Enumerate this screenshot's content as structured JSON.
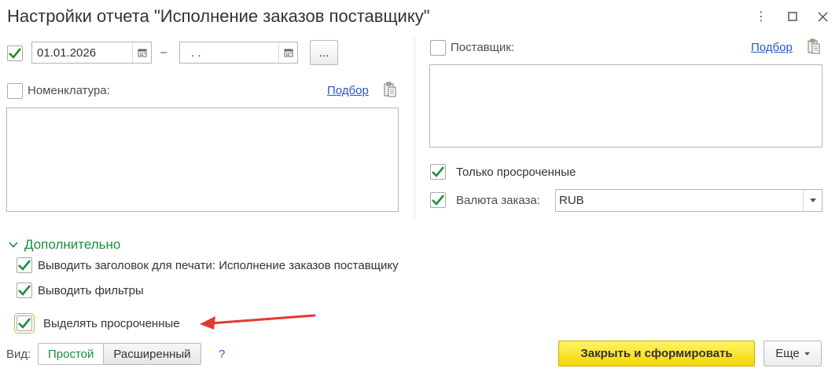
{
  "window": {
    "title": "Настройки отчета \"Исполнение заказов поставщику\"",
    "more_glyph": "⋮",
    "maximize_glyph": "☐",
    "close_glyph": "✕"
  },
  "period": {
    "enabled": true,
    "date_from": "01.01.2026",
    "separator": "–",
    "date_to": ". .",
    "choose_label": "..."
  },
  "nomenclature": {
    "checked": false,
    "label": "Номенклатура:",
    "pick_link": "Подбор"
  },
  "supplier": {
    "checked": false,
    "label": "Поставщик:",
    "pick_link": "Подбор"
  },
  "only_overdue": {
    "checked": true,
    "label": "Только просроченные"
  },
  "currency": {
    "checked": true,
    "label": "Валюта заказа:",
    "value": "RUB"
  },
  "additional": {
    "title": "Дополнительно",
    "options": [
      {
        "label": "Выводить заголовок для печати: Исполнение заказов поставщику",
        "checked": true
      },
      {
        "label": "Выводить фильтры",
        "checked": true
      },
      {
        "label": "Выделять просроченные",
        "checked": true
      }
    ]
  },
  "footer": {
    "view_label": "Вид:",
    "view_simple": "Простой",
    "view_extended": "Расширенный",
    "help_label": "?",
    "submit_label": "Закрыть и сформировать",
    "more_label": "Еще"
  },
  "colors": {
    "accent_green": "#1b8f3a",
    "link_blue": "#2458c7",
    "primary_yellow": "#f4d800",
    "arrow_red": "#e23a2e"
  }
}
